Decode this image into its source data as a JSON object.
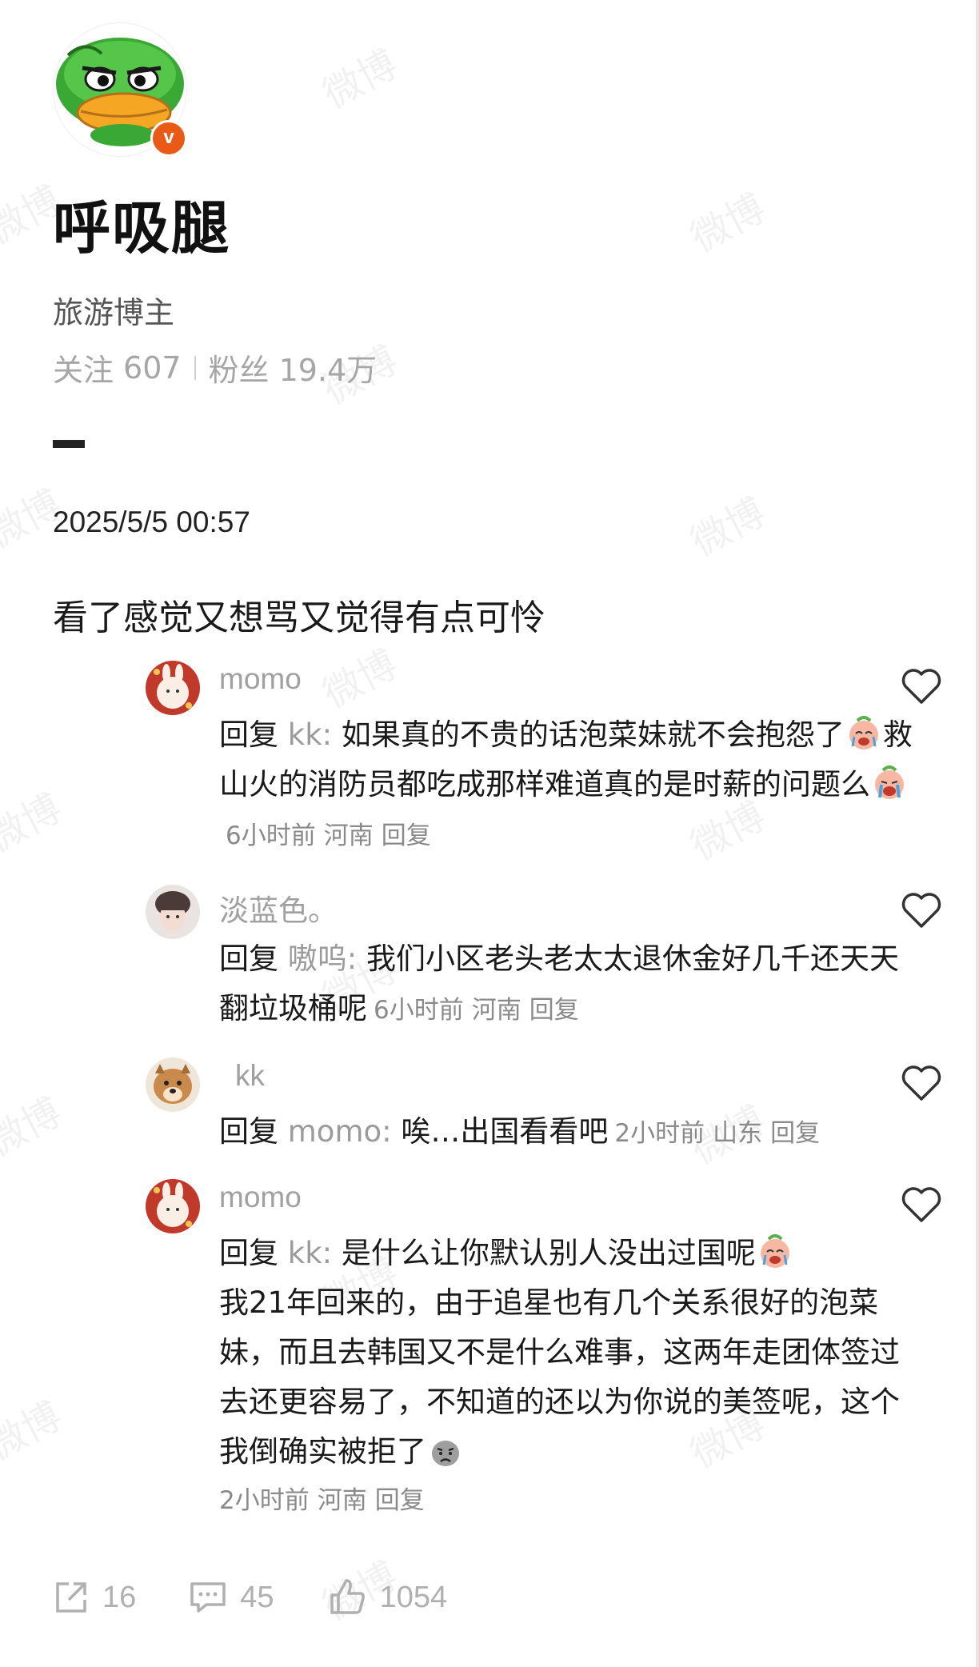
{
  "watermark": "微博",
  "profile": {
    "name": "呼吸腿",
    "bio": "旅游博主",
    "following_label": "关注",
    "following_count": "607",
    "followers_label": "粉丝",
    "followers_count": "19.4万",
    "verified_badge": "v"
  },
  "post": {
    "date": "2025/5/5 00:57",
    "text": "看了感觉又想骂又觉得有点可怜"
  },
  "comments": [
    {
      "user": "momo",
      "reply_prefix": "回复",
      "reply_to": "kk",
      "text_1": "如果真的不贵的话泡菜妹就不会抱怨了",
      "emoji_1": "cry-laugh-emoji",
      "text_2": "救山火的消防员都吃成那样难道真的是时薪的问题么",
      "emoji_2": "cry-emoji",
      "time": "6小时前",
      "location": "河南",
      "reply_label": "回复"
    },
    {
      "user": "淡蓝色。",
      "reply_prefix": "回复",
      "reply_to": "嗷呜",
      "text_1": "我们小区老头老太太退休金好几千还天天翻垃圾桶呢",
      "time": "6小时前",
      "location": "河南",
      "reply_label": "回复"
    },
    {
      "user": "kk",
      "reply_prefix": "回复",
      "reply_to": "momo",
      "text_1": "唉…出国看看吧",
      "time": "2小时前",
      "location": "山东",
      "reply_label": "回复"
    },
    {
      "user": "momo",
      "reply_prefix": "回复",
      "reply_to": "kk",
      "text_1": "是什么让你默认别人没出过国呢",
      "emoji_1": "cry-laugh-emoji",
      "text_2": "我21年回来的，由于追星也有几个关系很好的泡菜妹，而且去韩国又不是什么难事，这两年走团体签过去还更容易了，不知道的还以为你说的美签呢，这个我倒确实被拒了",
      "emoji_2": "sad-face-emoji",
      "time": "2小时前",
      "location": "河南",
      "reply_label": "回复"
    }
  ],
  "footer": {
    "share_count": "16",
    "comment_count": "45",
    "like_count": "1054"
  },
  "icons": [
    "duck-avatar-icon",
    "heart-icon",
    "share-icon",
    "comment-icon",
    "thumbs-up-icon"
  ],
  "colors": {
    "verified": "#e85a16",
    "muted": "#a0a0a0",
    "text": "#1a1a1a"
  }
}
